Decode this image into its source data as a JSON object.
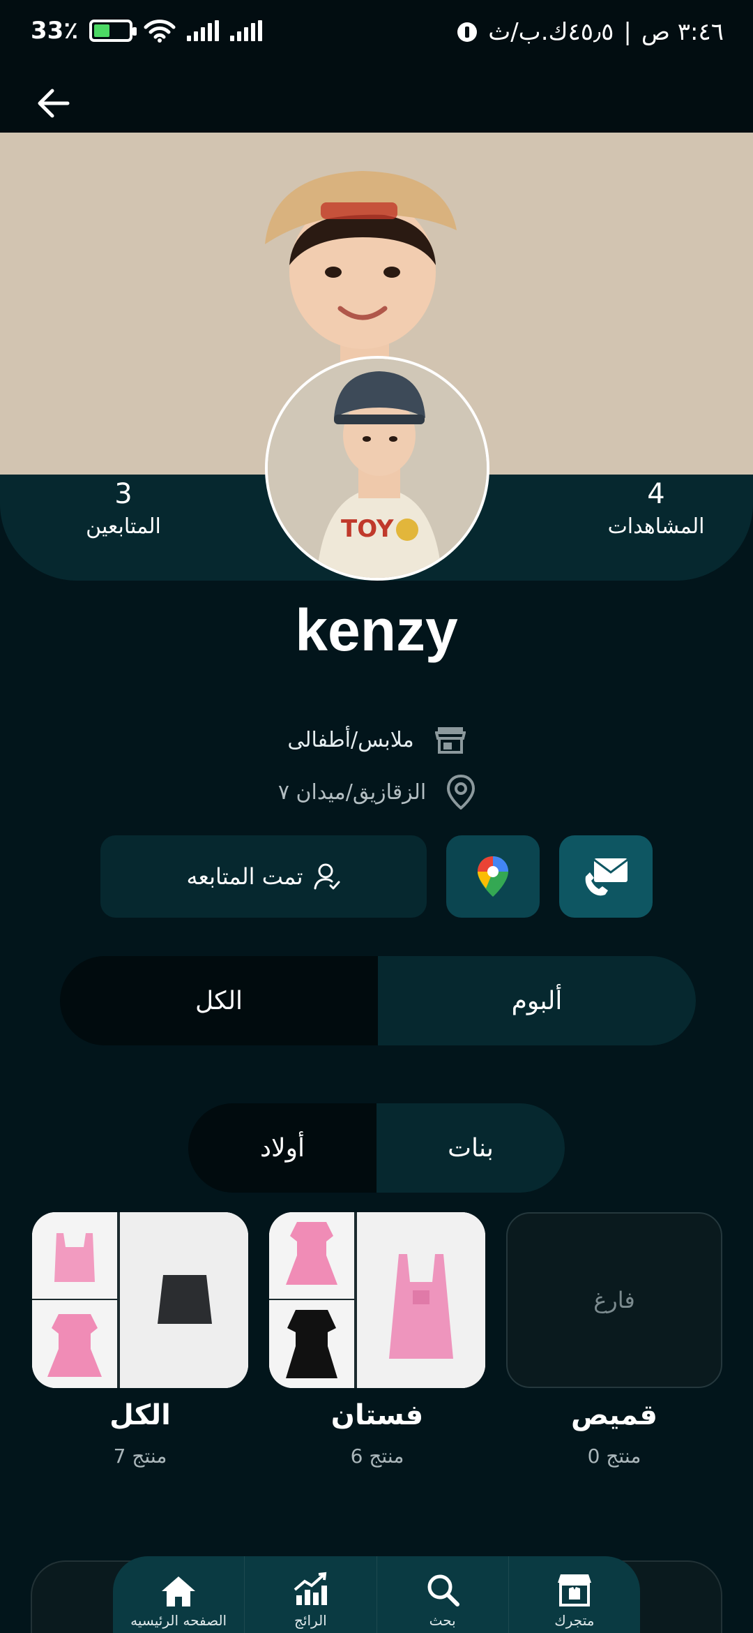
{
  "status_bar": {
    "time": "٣:٤٦ ص",
    "network_speed": "٤٥٫٥ك.ب/ث",
    "battery": "33٪",
    "battery_level": 0.33
  },
  "stats": {
    "views_count": "4",
    "views_label": "المشاهدات",
    "followers_count": "3",
    "followers_label": "المتابعين"
  },
  "store": {
    "name": "kenzy",
    "category": "ملابس/أطفالى",
    "location": "الزقازيق/ميدان ٧"
  },
  "actions": {
    "follow_label": "تمت المتابعه"
  },
  "tabs_primary": [
    "ألبوم",
    "الكل"
  ],
  "tabs_secondary": [
    "بنات",
    "أولاد"
  ],
  "albums": [
    {
      "title": "قميص",
      "count": "0 منتج",
      "empty_label": "فارغ"
    },
    {
      "title": "فستان",
      "count": "6 منتج"
    },
    {
      "title": "الكل",
      "count": "7 منتج"
    }
  ],
  "bottom_nav": [
    {
      "label": "متجرك",
      "icon": "store-icon"
    },
    {
      "label": "بحث",
      "icon": "search-icon"
    },
    {
      "label": "الرائج",
      "icon": "trending-icon"
    },
    {
      "label": "الصفحه الرئيسيه",
      "icon": "home-icon"
    }
  ],
  "colors": {
    "background": "#02151b",
    "panel": "#06282f",
    "accent": "#0e5662",
    "nav": "#0a3a42"
  }
}
